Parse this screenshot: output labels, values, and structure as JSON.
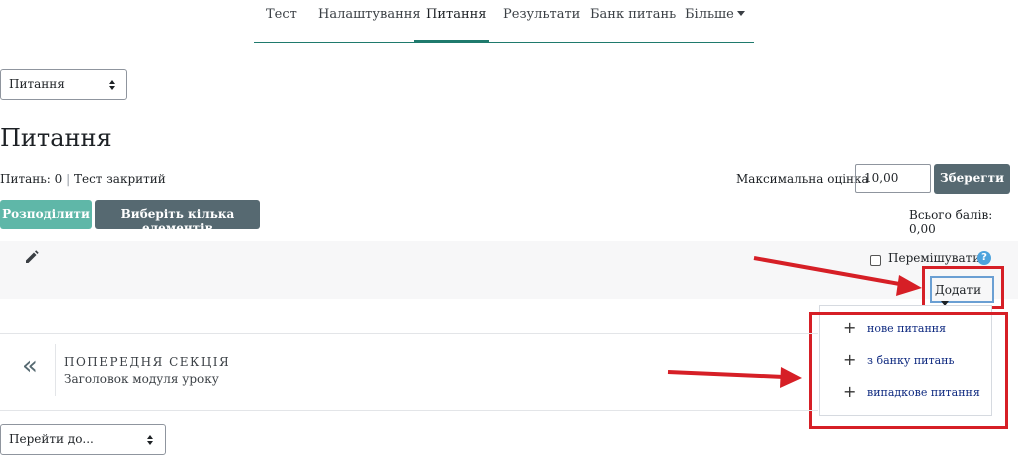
{
  "nav": {
    "tabs": [
      {
        "label": "Тест"
      },
      {
        "label": "Налаштування"
      },
      {
        "label": "Питання"
      },
      {
        "label": "Результати"
      },
      {
        "label": "Банк питань"
      },
      {
        "label": "Більше"
      }
    ],
    "active_tab": "Питання"
  },
  "view_select": {
    "value": "Питання"
  },
  "page": {
    "title": "Питання"
  },
  "summary": {
    "questions_info": "Питань: 0",
    "separator": "|",
    "quiz_status": "Тест закритий",
    "max_grade_label": "Максимальна оцінка",
    "max_grade_value": "10,00",
    "save_label": "Зберегти",
    "total_marks": "Всього балів: 0,00"
  },
  "toolbar": {
    "repaginate_label": "Розподілити",
    "select_multiple_label": "Виберіть кілька елементів"
  },
  "section": {
    "shuffle_label": "Перемішувати",
    "help_symbol": "?",
    "add_label": "Додати"
  },
  "add_menu": {
    "items": [
      {
        "icon": "plus-icon",
        "label": "нове питання"
      },
      {
        "icon": "plus-icon",
        "label": "з банку питань"
      },
      {
        "icon": "plus-icon",
        "label": "випадкове питання"
      }
    ]
  },
  "prev_section": {
    "icon": "double-chevron-left-icon",
    "kicker": "ПОПЕРЕДНЯ СЕКЦІЯ",
    "title": "Заголовок модуля уроку"
  },
  "jump_select": {
    "value": "Перейти до..."
  },
  "colors": {
    "accent_teal": "#1f7a6d",
    "button_gray": "#566971",
    "button_teal": "#5fb7a8",
    "annotation_red": "#d61f26",
    "link_blue": "#0f2a80"
  }
}
